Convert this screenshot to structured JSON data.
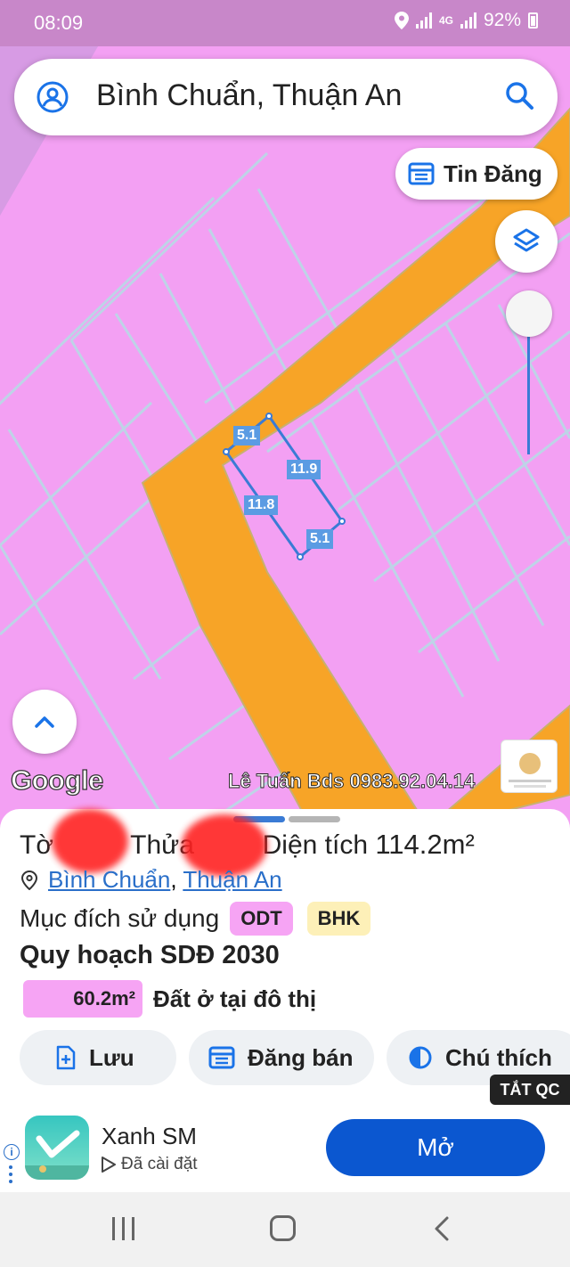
{
  "status_bar": {
    "time": "08:09",
    "network": "4G",
    "battery": "92%"
  },
  "search": {
    "title": "Bình Chuẩn, Thuận An"
  },
  "map_controls": {
    "tin_dang_label": "Tin Đăng"
  },
  "parcel": {
    "edges": [
      "5.1",
      "11.9",
      "11.8",
      "5.1"
    ]
  },
  "map_attribution": {
    "google": "Google",
    "watermark": "Lê Tuấn Bds 0983.92.04.14"
  },
  "sheet": {
    "to_label": "Tờ",
    "thua_label": "Thửa",
    "dien_tich_label": "Diện tích",
    "area": "114.2m²",
    "address_ward": "Bình Chuẩn",
    "address_sep": ",",
    "address_city": "Thuận An",
    "purpose_label": "Mục đích sử dụng",
    "purpose_tags": [
      "ODT",
      "BHK"
    ],
    "plan_title": "Quy hoạch SDĐ 2030",
    "plan_area": "60.2m²",
    "plan_desc": "Đất ở tại đô thị",
    "actions": {
      "save": "Lưu",
      "sell": "Đăng bán",
      "legend": "Chú thích"
    }
  },
  "ad": {
    "close_label": "TẮT QC",
    "app_name": "Xanh SM",
    "installed": "Đã cài đặt",
    "open_label": "Mở"
  },
  "colors": {
    "residential": "#f3a0f3",
    "road": "#f7a427",
    "accent": "#3a7bd5",
    "ad_button": "#0b57d0"
  }
}
